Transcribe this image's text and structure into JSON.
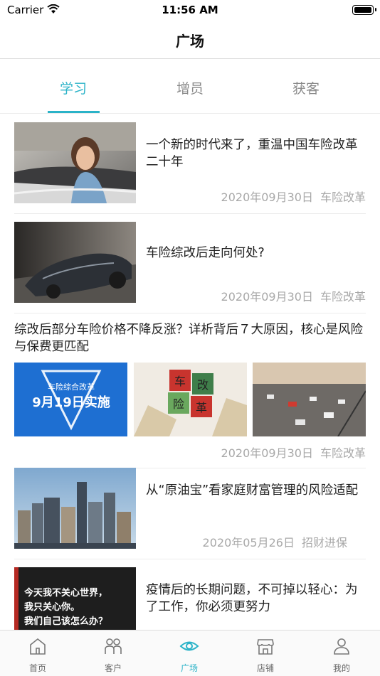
{
  "status_bar": {
    "carrier": "Carrier",
    "time": "11:56 AM"
  },
  "nav": {
    "title": "广场"
  },
  "tabs": [
    {
      "label": "学习",
      "active": true
    },
    {
      "label": "增员",
      "active": false
    },
    {
      "label": "获客",
      "active": false
    }
  ],
  "articles": [
    {
      "title": "一个新的时代来了，重温中国车险改革二十年",
      "date": "2020年09月30日",
      "tag": "车险改革",
      "image": "woman-in-convertible"
    },
    {
      "title": "车险综改后走向何处?",
      "date": "2020年09月30日",
      "tag": "车险改革",
      "image": "sports-car"
    },
    {
      "title": "综改后部分车险价格不降反涨？详析背后７大原因，核心是风险与保费更匹配",
      "date": "2020年09月30日",
      "tag": "车险改革",
      "images": [
        "reform-banner",
        "reform-blocks-illustration",
        "highway-traffic"
      ],
      "banner_small": "车险综合改革",
      "banner_big": "9月19日实施",
      "blocks": [
        "车",
        "险",
        "改",
        "革"
      ]
    },
    {
      "title": "从“原油宝”看家庭财富管理的风险适配",
      "date": "2020年05月26日",
      "tag": "招财进保",
      "image": "city-skyline"
    },
    {
      "title": "疫情后的长期问题，不可掉以轻心：为了工作，你必须更努力",
      "image": "text-poster",
      "poster_lines": [
        "今天我不关心世界，",
        "我只关心你。",
        "我们自己该怎么办？"
      ]
    }
  ],
  "tabbar": [
    {
      "label": "首页",
      "icon": "home-icon",
      "active": false
    },
    {
      "label": "客户",
      "icon": "customers-icon",
      "active": false
    },
    {
      "label": "广场",
      "icon": "eye-icon",
      "active": true
    },
    {
      "label": "店铺",
      "icon": "store-icon",
      "active": false
    },
    {
      "label": "我的",
      "icon": "profile-icon",
      "active": false
    }
  ],
  "colors": {
    "accent": "#2bb3c8",
    "meta": "#a8a8a8",
    "divider": "#ececec"
  }
}
